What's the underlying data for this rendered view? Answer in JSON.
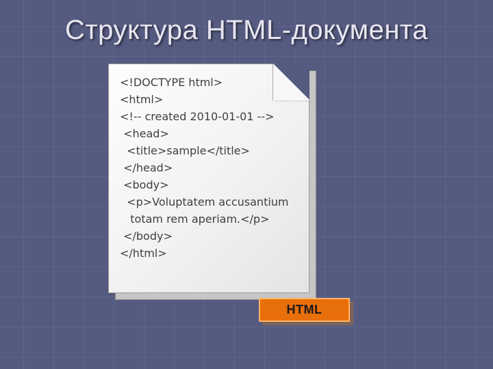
{
  "title": "Структура HTML-документа",
  "code_lines": [
    "<!DOCTYPE html>",
    "<html>",
    "<!-- created 2010-01-01 -->",
    " <head>",
    "  <title>sample</title>",
    " </head>",
    " <body>",
    "  <p>Voluptatem accusantium",
    "   totam rem aperiam.</p>",
    " </body>",
    "</html>"
  ],
  "badge": "HTML"
}
